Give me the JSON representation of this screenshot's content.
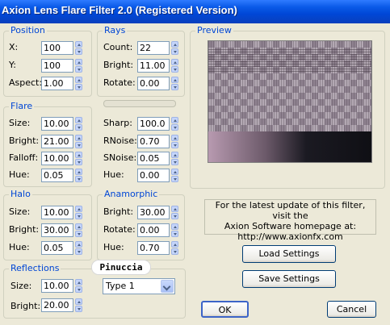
{
  "window": {
    "title": "Axion Lens Flare Filter 2.0 (Registered Version)"
  },
  "position": {
    "label": "Position",
    "x": {
      "label": "X:",
      "value": "100"
    },
    "y": {
      "label": "Y:",
      "value": "100"
    },
    "aspect": {
      "label": "Aspect:",
      "value": "1.00"
    }
  },
  "rays": {
    "label": "Rays",
    "count": {
      "label": "Count:",
      "value": "22"
    },
    "bright": {
      "label": "Bright:",
      "value": "11.00"
    },
    "rotate": {
      "label": "Rotate:",
      "value": "0.00"
    },
    "sharp": {
      "label": "Sharp:",
      "value": "100.0"
    },
    "rnoise": {
      "label": "RNoise:",
      "value": "0.70"
    },
    "snoise": {
      "label": "SNoise:",
      "value": "0.05"
    },
    "hue": {
      "label": "Hue:",
      "value": "0.00"
    }
  },
  "flare": {
    "label": "Flare",
    "size": {
      "label": "Size:",
      "value": "10.00"
    },
    "bright": {
      "label": "Bright:",
      "value": "21.00"
    },
    "falloff": {
      "label": "Falloff:",
      "value": "10.00"
    },
    "hue": {
      "label": "Hue:",
      "value": "0.05"
    }
  },
  "halo": {
    "label": "Halo",
    "size": {
      "label": "Size:",
      "value": "10.00"
    },
    "bright": {
      "label": "Bright:",
      "value": "30.00"
    },
    "hue": {
      "label": "Hue:",
      "value": "0.05"
    }
  },
  "anamorphic": {
    "label": "Anamorphic",
    "bright": {
      "label": "Bright:",
      "value": "30.00"
    },
    "rotate": {
      "label": "Rotate:",
      "value": "0.00"
    },
    "hue": {
      "label": "Hue:",
      "value": "0.70"
    }
  },
  "reflections": {
    "label": "Reflections",
    "size": {
      "label": "Size:",
      "value": "10.00"
    },
    "bright": {
      "label": "Bright:",
      "value": "20.00"
    },
    "type": "Type 1"
  },
  "preview": {
    "label": "Preview"
  },
  "info": {
    "line1": "For the latest update of this filter, visit the",
    "line2": "Axion Software homepage at:",
    "line3": "http://www.axionfx.com"
  },
  "buttons": {
    "load": "Load Settings",
    "save": "Save Settings",
    "ok": "OK",
    "cancel": "Cancel"
  },
  "watermark": "Pinuccia"
}
